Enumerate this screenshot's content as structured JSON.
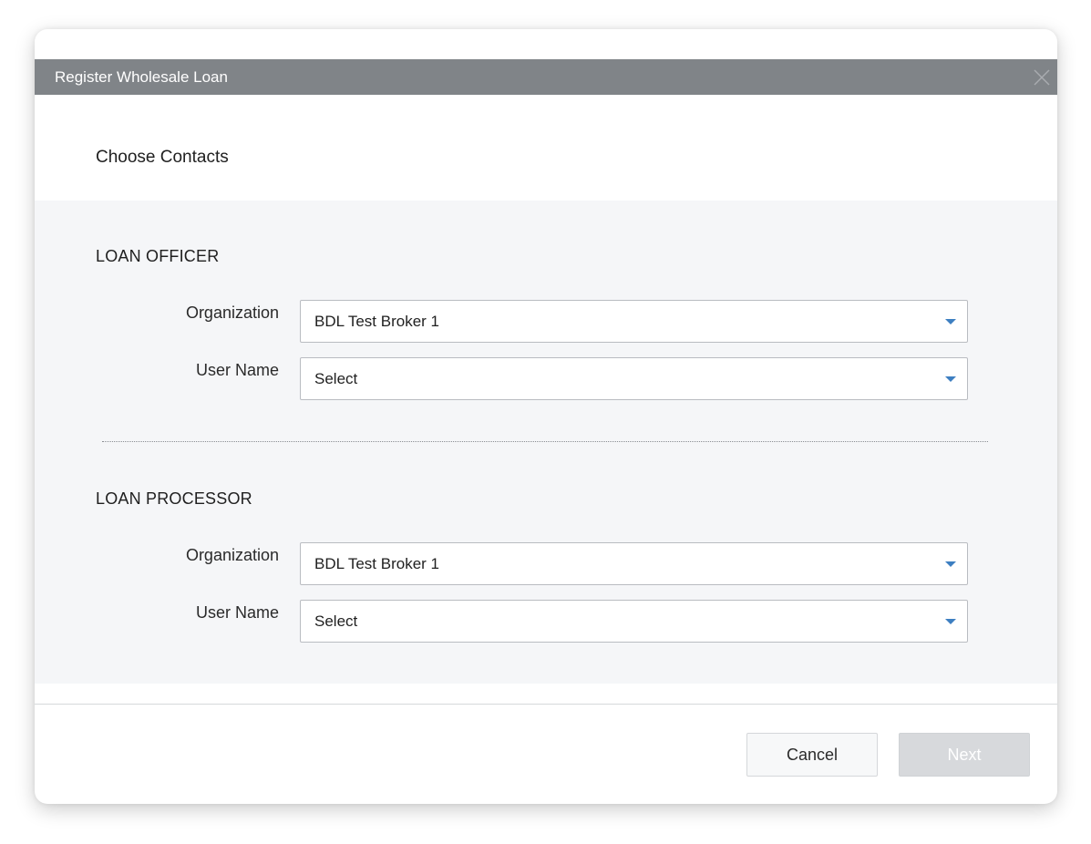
{
  "dialog": {
    "title": "Register Wholesale Loan",
    "close_icon": "close-icon",
    "heading": "Choose Contacts"
  },
  "loan_officer": {
    "title": "LOAN OFFICER",
    "organization_label": "Organization",
    "organization_value": "BDL Test Broker 1",
    "username_label": "User Name",
    "username_value": "Select"
  },
  "loan_processor": {
    "title": "LOAN PROCESSOR",
    "organization_label": "Organization",
    "organization_value": "BDL Test Broker 1",
    "username_label": "User Name",
    "username_value": "Select"
  },
  "footer": {
    "cancel_label": "Cancel",
    "next_label": "Next",
    "next_disabled": true
  },
  "colors": {
    "titlebar": "#808488",
    "accent_caret": "#3d7fc1",
    "content_bg": "#f5f6f8"
  }
}
